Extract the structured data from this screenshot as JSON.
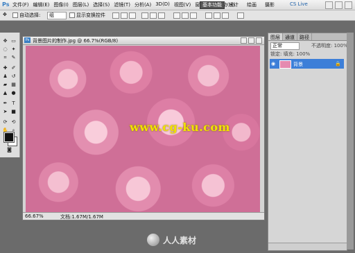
{
  "app": {
    "logo": "Ps"
  },
  "menu": [
    "文件(F)",
    "编辑(E)",
    "图像(I)",
    "图层(L)",
    "选择(S)",
    "滤镜(T)",
    "分析(A)",
    "3D(D)",
    "视图(V)",
    "窗口(W)",
    "帮助(H)"
  ],
  "titlebar": {
    "zoom": "66.7",
    "workspace_active": "基本功能",
    "workspace_links": [
      "设计",
      "绘画",
      "摄影"
    ],
    "cslive": "CS Live"
  },
  "options": {
    "auto_select_label": "自动选择:",
    "auto_select_value": "组",
    "show_transform_label": "显示变换控件"
  },
  "document": {
    "title": "背景图片的制作.jpg @ 66.7%(RGB/8)",
    "zoom": "66.67%",
    "info": "文档:1.67M/1.67M",
    "watermark": "www.cg-ku.com"
  },
  "layers_panel": {
    "tabs": [
      "图层",
      "通道",
      "路径"
    ],
    "blend_mode": "正常",
    "opacity_label": "不透明度: 100%",
    "lock_label": "锁定: 填充: 100%",
    "layer_name": "背景"
  },
  "brand": {
    "text": "人人素材"
  },
  "colors": {
    "foreground": "#111111",
    "background": "#ffffff",
    "selected_layer": "#3d7fd8"
  }
}
